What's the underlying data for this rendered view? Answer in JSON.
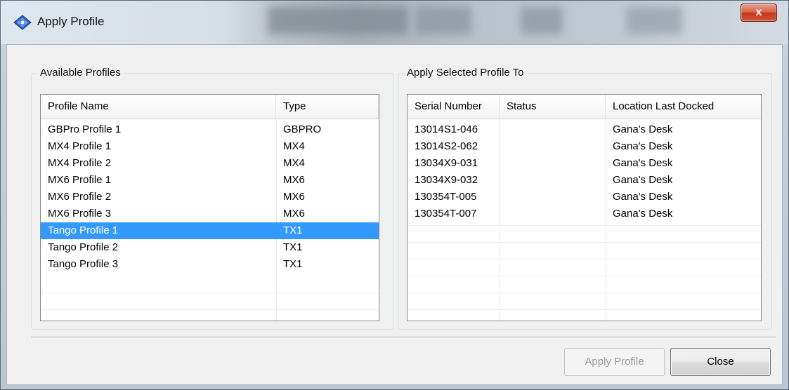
{
  "window": {
    "title": "Apply Profile",
    "close_glyph": "x"
  },
  "available_profiles": {
    "group_label": "Available Profiles",
    "columns": [
      "Profile Name",
      "Type"
    ],
    "rows": [
      {
        "name": "GBPro Profile 1",
        "type": "GBPRO",
        "selected": false
      },
      {
        "name": "MX4 Profile 1",
        "type": "MX4",
        "selected": false
      },
      {
        "name": "MX4 Profile 2",
        "type": "MX4",
        "selected": false
      },
      {
        "name": "MX6 Profile 1",
        "type": "MX6",
        "selected": false
      },
      {
        "name": "MX6 Profile 2",
        "type": "MX6",
        "selected": false
      },
      {
        "name": "MX6 Profile 3",
        "type": "MX6",
        "selected": false
      },
      {
        "name": "Tango Profile 1",
        "type": "TX1",
        "selected": true
      },
      {
        "name": "Tango Profile 2",
        "type": "TX1",
        "selected": false
      },
      {
        "name": "Tango Profile 3",
        "type": "TX1",
        "selected": false
      }
    ]
  },
  "apply_to": {
    "group_label": "Apply Selected Profile To",
    "columns": [
      "Serial Number",
      "Status",
      "Location Last Docked"
    ],
    "rows": [
      {
        "serial": "13014S1-046",
        "status": "",
        "location": "Gana's Desk"
      },
      {
        "serial": "13014S2-062",
        "status": "",
        "location": "Gana's Desk"
      },
      {
        "serial": "13034X9-031",
        "status": "",
        "location": "Gana's Desk"
      },
      {
        "serial": "13034X9-032",
        "status": "",
        "location": "Gana's Desk"
      },
      {
        "serial": "130354T-005",
        "status": "",
        "location": "Gana's Desk"
      },
      {
        "serial": "130354T-007",
        "status": "",
        "location": "Gana's Desk"
      }
    ]
  },
  "buttons": {
    "apply_label": "Apply Profile",
    "apply_enabled": false,
    "close_label": "Close"
  },
  "colors": {
    "selection": "#3399ff",
    "client_background": "#f0f0f0",
    "close_button_red": "#c3371c"
  },
  "icons": {
    "app": "blue-diamond-device-icon",
    "close": "close-icon"
  }
}
